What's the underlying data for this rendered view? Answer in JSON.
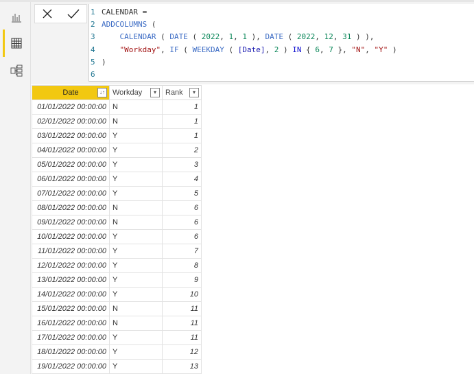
{
  "sidebar": {
    "items": [
      {
        "name": "report",
        "icon": "bar-chart-icon"
      },
      {
        "name": "data",
        "icon": "table-icon",
        "active": true
      },
      {
        "name": "model",
        "icon": "model-icon"
      }
    ]
  },
  "formula": {
    "line_numbers": [
      "1",
      "2",
      "3",
      "4",
      "5",
      "6"
    ],
    "lines": [
      [
        {
          "t": "CALENDAR =",
          "c": ""
        }
      ],
      [
        {
          "t": "ADDCOLUMNS",
          "c": "kw"
        },
        {
          "t": " (",
          "c": ""
        }
      ],
      [
        {
          "t": "    ",
          "c": ""
        },
        {
          "t": "CALENDAR",
          "c": "kw"
        },
        {
          "t": " ( ",
          "c": ""
        },
        {
          "t": "DATE",
          "c": "kw"
        },
        {
          "t": " ( ",
          "c": ""
        },
        {
          "t": "2022",
          "c": "num"
        },
        {
          "t": ", ",
          "c": ""
        },
        {
          "t": "1",
          "c": "num"
        },
        {
          "t": ", ",
          "c": ""
        },
        {
          "t": "1",
          "c": "num"
        },
        {
          "t": " ), ",
          "c": ""
        },
        {
          "t": "DATE",
          "c": "kw"
        },
        {
          "t": " ( ",
          "c": ""
        },
        {
          "t": "2022",
          "c": "num"
        },
        {
          "t": ", ",
          "c": ""
        },
        {
          "t": "12",
          "c": "num"
        },
        {
          "t": ", ",
          "c": ""
        },
        {
          "t": "31",
          "c": "num"
        },
        {
          "t": " ) ),",
          "c": ""
        }
      ],
      [
        {
          "t": "    ",
          "c": ""
        },
        {
          "t": "\"Workday\"",
          "c": "str"
        },
        {
          "t": ", ",
          "c": ""
        },
        {
          "t": "IF",
          "c": "kw"
        },
        {
          "t": " ( ",
          "c": ""
        },
        {
          "t": "WEEKDAY",
          "c": "kw"
        },
        {
          "t": " ( ",
          "c": ""
        },
        {
          "t": "[Date]",
          "c": "col"
        },
        {
          "t": ", ",
          "c": ""
        },
        {
          "t": "2",
          "c": "num"
        },
        {
          "t": " ) ",
          "c": ""
        },
        {
          "t": "IN",
          "c": "op"
        },
        {
          "t": " { ",
          "c": ""
        },
        {
          "t": "6",
          "c": "num"
        },
        {
          "t": ", ",
          "c": ""
        },
        {
          "t": "7",
          "c": "num"
        },
        {
          "t": " }, ",
          "c": ""
        },
        {
          "t": "\"N\"",
          "c": "str"
        },
        {
          "t": ", ",
          "c": ""
        },
        {
          "t": "\"Y\"",
          "c": "str"
        },
        {
          "t": " )",
          "c": ""
        }
      ],
      [
        {
          "t": ")",
          "c": ""
        }
      ],
      [
        {
          "t": "",
          "c": ""
        }
      ]
    ]
  },
  "table": {
    "columns": [
      "Date",
      "Workday",
      "Rank"
    ],
    "rows": [
      [
        "01/01/2022 00:00:00",
        "N",
        "1"
      ],
      [
        "02/01/2022 00:00:00",
        "N",
        "1"
      ],
      [
        "03/01/2022 00:00:00",
        "Y",
        "1"
      ],
      [
        "04/01/2022 00:00:00",
        "Y",
        "2"
      ],
      [
        "05/01/2022 00:00:00",
        "Y",
        "3"
      ],
      [
        "06/01/2022 00:00:00",
        "Y",
        "4"
      ],
      [
        "07/01/2022 00:00:00",
        "Y",
        "5"
      ],
      [
        "08/01/2022 00:00:00",
        "N",
        "6"
      ],
      [
        "09/01/2022 00:00:00",
        "N",
        "6"
      ],
      [
        "10/01/2022 00:00:00",
        "Y",
        "6"
      ],
      [
        "11/01/2022 00:00:00",
        "Y",
        "7"
      ],
      [
        "12/01/2022 00:00:00",
        "Y",
        "8"
      ],
      [
        "13/01/2022 00:00:00",
        "Y",
        "9"
      ],
      [
        "14/01/2022 00:00:00",
        "Y",
        "10"
      ],
      [
        "15/01/2022 00:00:00",
        "N",
        "11"
      ],
      [
        "16/01/2022 00:00:00",
        "N",
        "11"
      ],
      [
        "17/01/2022 00:00:00",
        "Y",
        "11"
      ],
      [
        "18/01/2022 00:00:00",
        "Y",
        "12"
      ],
      [
        "19/01/2022 00:00:00",
        "Y",
        "13"
      ]
    ]
  },
  "colors": {
    "accent": "#f2c811"
  }
}
